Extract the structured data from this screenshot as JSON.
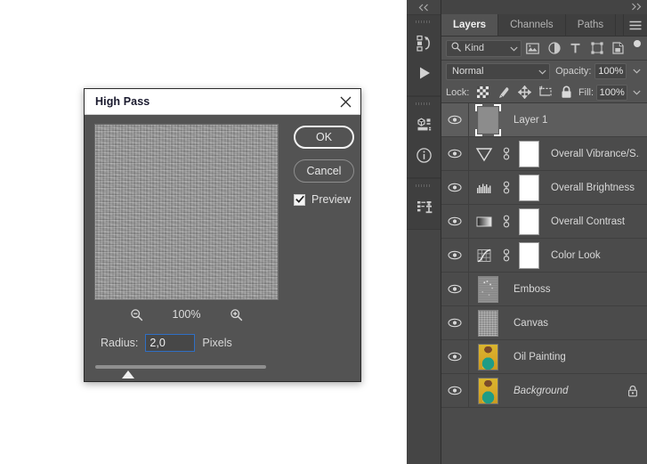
{
  "dialog": {
    "title": "High Pass",
    "close_icon": "close-icon",
    "ok_label": "OK",
    "cancel_label": "Cancel",
    "preview_label": "Preview",
    "preview_checked": true,
    "zoom_out_icon": "zoom-out-icon",
    "zoom_in_icon": "zoom-in-icon",
    "zoom_percent": "100%",
    "radius_label": "Radius:",
    "radius_value": "2,0",
    "radius_units": "Pixels",
    "focus_color": "#2f6fc4"
  },
  "dock_strip": {
    "collapse_icon": "collapse-left-icon",
    "groups": [
      {
        "icons": [
          "history-icon",
          "actions-play-icon"
        ]
      },
      {
        "icons": [
          "properties-icon",
          "info-icon"
        ]
      },
      {
        "icons": [
          "clone-source-icon"
        ]
      }
    ]
  },
  "layers_panel": {
    "collapse_icon": "collapse-right-icon",
    "menu_icon": "panel-menu-icon",
    "tabs": [
      {
        "label": "Layers",
        "active": true
      },
      {
        "label": "Channels",
        "active": false
      },
      {
        "label": "Paths",
        "active": false
      }
    ],
    "filter": {
      "search_icon": "search-icon",
      "kind_label": "Kind",
      "caret_icon": "chevron-down-icon",
      "icons": [
        "filter-pixel-icon",
        "filter-adjustment-icon",
        "filter-type-icon",
        "filter-shape-icon",
        "filter-smart-object-icon"
      ],
      "toggle_icon": "filter-toggle-icon"
    },
    "blend": {
      "mode": "Normal",
      "mode_caret_icon": "chevron-down-icon",
      "opacity_label": "Opacity:",
      "opacity_value": "100%",
      "opacity_caret_icon": "chevron-down-icon"
    },
    "lock": {
      "label": "Lock:",
      "icons": [
        "lock-transparent-pixels-icon",
        "lock-image-pixels-icon",
        "lock-position-icon",
        "lock-artboard-nesting-icon",
        "lock-all-icon"
      ],
      "fill_label": "Fill:",
      "fill_value": "100%",
      "fill_caret_icon": "chevron-down-icon"
    },
    "layers": [
      {
        "name": "Layer 1",
        "visible": true,
        "selected": true,
        "kind": "pixel",
        "thumb": "gray",
        "italic": false,
        "locked": false
      },
      {
        "name": "Overall Vibrance/S...",
        "visible": true,
        "selected": false,
        "kind": "adjustment",
        "adj_icon": "vibrance-icon",
        "link_icon": "link-mask-icon",
        "mask": true,
        "italic": false,
        "locked": false
      },
      {
        "name": "Overall Brightness",
        "visible": true,
        "selected": false,
        "kind": "adjustment",
        "adj_icon": "brightness-icon",
        "link_icon": "link-mask-icon",
        "mask": true,
        "italic": false,
        "locked": false
      },
      {
        "name": "Overall Contrast",
        "visible": true,
        "selected": false,
        "kind": "adjustment",
        "adj_icon": "contrast-icon",
        "link_icon": "link-mask-icon",
        "mask": true,
        "italic": false,
        "locked": false
      },
      {
        "name": "Color Look",
        "visible": true,
        "selected": false,
        "kind": "adjustment",
        "adj_icon": "curves-icon",
        "link_icon": "link-mask-icon",
        "mask": true,
        "italic": false,
        "locked": false
      },
      {
        "name": "Emboss",
        "visible": true,
        "selected": false,
        "kind": "pixel",
        "thumb": "emboss",
        "italic": false,
        "locked": false
      },
      {
        "name": "Canvas",
        "visible": true,
        "selected": false,
        "kind": "pixel",
        "thumb": "canvas",
        "italic": false,
        "locked": false
      },
      {
        "name": "Oil Painting",
        "visible": true,
        "selected": false,
        "kind": "pixel",
        "thumb": "photo",
        "italic": false,
        "locked": false
      },
      {
        "name": "Background",
        "visible": true,
        "selected": false,
        "kind": "pixel",
        "thumb": "photo",
        "italic": true,
        "locked": true,
        "lock_icon": "lock-icon"
      }
    ]
  }
}
